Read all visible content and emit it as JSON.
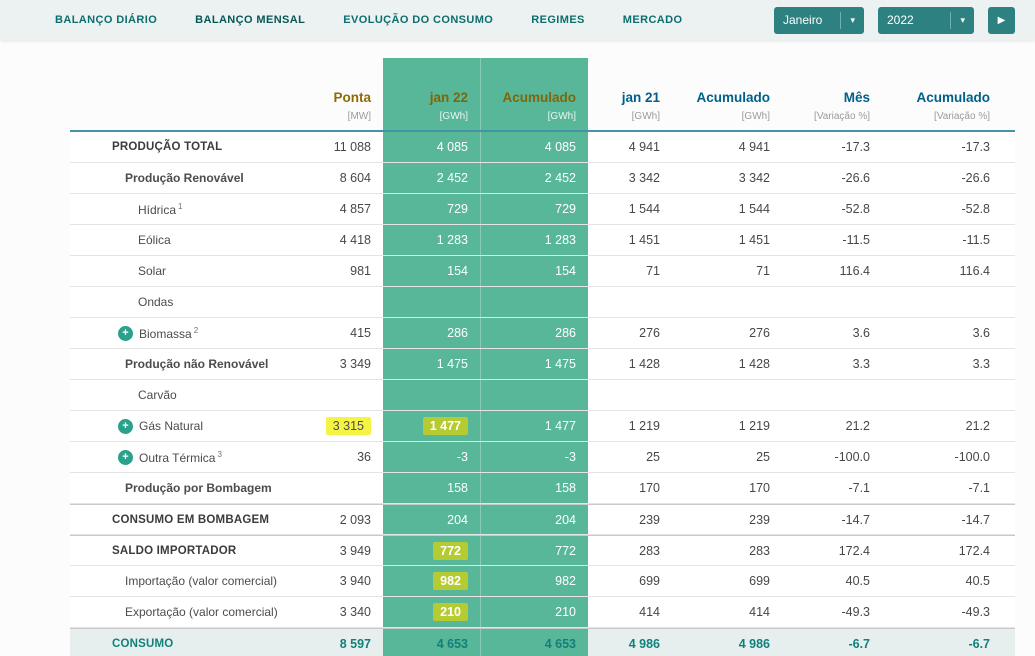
{
  "nav": {
    "items": [
      {
        "label": "BALANÇO DIÁRIO",
        "active": false
      },
      {
        "label": "BALANÇO MENSAL",
        "active": true
      },
      {
        "label": "EVOLUÇÃO DO CONSUMO",
        "active": false
      },
      {
        "label": "REGIMES",
        "active": false
      },
      {
        "label": "MERCADO",
        "active": false
      }
    ],
    "month_dropdown": {
      "value": "Janeiro",
      "caret": "▾"
    },
    "year_dropdown": {
      "value": "2022",
      "caret": "▾"
    },
    "next_button": "▶"
  },
  "colors": {
    "green_column": "#58b798",
    "highlight_yellow": "#f6f442",
    "highlight_lime": "#b6cb31",
    "header_gold": "#8f6b00",
    "header_blue": "#00608a",
    "teal_nav": "#0d6e6e",
    "consumo_row_bg": "#e7efee"
  },
  "table": {
    "columns": [
      {
        "key": "ponta",
        "label": "Ponta",
        "unit": "[MW]",
        "style": "gold"
      },
      {
        "key": "jan22",
        "label": "jan 22",
        "unit": "[GWh]",
        "style": "gold-on-green"
      },
      {
        "key": "acum22",
        "label": "Acumulado",
        "unit": "[GWh]",
        "style": "gold-on-green"
      },
      {
        "key": "jan21",
        "label": "jan 21",
        "unit": "[GWh]",
        "style": "blue"
      },
      {
        "key": "acum21",
        "label": "Acumulado",
        "unit": "[GWh]",
        "style": "blue"
      },
      {
        "key": "mes",
        "label": "Mês",
        "unit": "[Variação %]",
        "style": "blue"
      },
      {
        "key": "acum_var",
        "label": "Acumulado",
        "unit": "[Variação %]",
        "style": "blue"
      }
    ],
    "rows": [
      {
        "label": "PRODUÇÃO TOTAL",
        "style": "caps",
        "indent": 1,
        "cells": {
          "ponta": "11 088",
          "jan22": "4 085",
          "acum22": "4 085",
          "jan21": "4 941",
          "acum21": "4 941",
          "mes": "-17.3",
          "acum_var": "-17.3"
        }
      },
      {
        "label": "Produção Renovável",
        "style": "bold",
        "indent": 2,
        "cells": {
          "ponta": "8 604",
          "jan22": "2 452",
          "acum22": "2 452",
          "jan21": "3 342",
          "acum21": "3 342",
          "mes": "-26.6",
          "acum_var": "-26.6"
        }
      },
      {
        "label": "Hídrica",
        "sup": "1",
        "style": "normal",
        "indent": 3,
        "cells": {
          "ponta": "4 857",
          "jan22": "729",
          "acum22": "729",
          "jan21": "1 544",
          "acum21": "1 544",
          "mes": "-52.8",
          "acum_var": "-52.8"
        }
      },
      {
        "label": "Eólica",
        "style": "normal",
        "indent": 3,
        "cells": {
          "ponta": "4 418",
          "jan22": "1 283",
          "acum22": "1 283",
          "jan21": "1 451",
          "acum21": "1 451",
          "mes": "-11.5",
          "acum_var": "-11.5"
        }
      },
      {
        "label": "Solar",
        "style": "normal",
        "indent": 3,
        "cells": {
          "ponta": "981",
          "jan22": "154",
          "acum22": "154",
          "jan21": "71",
          "acum21": "71",
          "mes": "116.4",
          "acum_var": "116.4"
        }
      },
      {
        "label": "Ondas",
        "style": "normal",
        "indent": 3,
        "cells": {}
      },
      {
        "label": "Biomassa",
        "sup": "2",
        "style": "normal",
        "indent": 3,
        "plus": true,
        "cells": {
          "ponta": "415",
          "jan22": "286",
          "acum22": "286",
          "jan21": "276",
          "acum21": "276",
          "mes": "3.6",
          "acum_var": "3.6"
        }
      },
      {
        "label": "Produção não Renovável",
        "style": "bold",
        "indent": 2,
        "cells": {
          "ponta": "3 349",
          "jan22": "1 475",
          "acum22": "1 475",
          "jan21": "1 428",
          "acum21": "1 428",
          "mes": "3.3",
          "acum_var": "3.3"
        }
      },
      {
        "label": "Carvão",
        "style": "normal",
        "indent": 3,
        "cells": {}
      },
      {
        "label": "Gás Natural",
        "style": "normal",
        "indent": 3,
        "plus": true,
        "cells": {
          "ponta": "3 315",
          "jan22": "1 477",
          "acum22": "1 477",
          "jan21": "1 219",
          "acum21": "1 219",
          "mes": "21.2",
          "acum_var": "21.2"
        },
        "highlights": {
          "ponta": "yellow",
          "jan22": "lime"
        }
      },
      {
        "label": "Outra Térmica",
        "sup": "3",
        "style": "normal",
        "indent": 3,
        "plus": true,
        "cells": {
          "ponta": "36",
          "jan22": "-3",
          "acum22": "-3",
          "jan21": "25",
          "acum21": "25",
          "mes": "-100.0",
          "acum_var": "-100.0"
        }
      },
      {
        "label": "Produção por Bombagem",
        "style": "bold",
        "indent": 2,
        "cells": {
          "jan22": "158",
          "acum22": "158",
          "jan21": "170",
          "acum21": "170",
          "mes": "-7.1",
          "acum_var": "-7.1"
        }
      },
      {
        "label": "CONSUMO EM BOMBAGEM",
        "style": "caps",
        "indent": 1,
        "section": true,
        "cells": {
          "ponta": "2 093",
          "jan22": "204",
          "acum22": "204",
          "jan21": "239",
          "acum21": "239",
          "mes": "-14.7",
          "acum_var": "-14.7"
        }
      },
      {
        "label": "SALDO IMPORTADOR",
        "style": "caps",
        "indent": 1,
        "section": true,
        "cells": {
          "ponta": "3 949",
          "jan22": "772",
          "acum22": "772",
          "jan21": "283",
          "acum21": "283",
          "mes": "172.4",
          "acum_var": "172.4"
        },
        "highlights": {
          "jan22": "lime"
        }
      },
      {
        "label": "Importação (valor comercial)",
        "style": "normal",
        "indent": 2,
        "cells": {
          "ponta": "3 940",
          "jan22": "982",
          "acum22": "982",
          "jan21": "699",
          "acum21": "699",
          "mes": "40.5",
          "acum_var": "40.5"
        },
        "highlights": {
          "jan22": "lime"
        }
      },
      {
        "label": "Exportação (valor comercial)",
        "style": "normal",
        "indent": 2,
        "cells": {
          "ponta": "3 340",
          "jan22": "210",
          "acum22": "210",
          "jan21": "414",
          "acum21": "414",
          "mes": "-49.3",
          "acum_var": "-49.3"
        },
        "highlights": {
          "jan22": "lime"
        }
      },
      {
        "label": "CONSUMO",
        "style": "consumo",
        "indent": 1,
        "section": true,
        "cells": {
          "ponta": "8 597",
          "jan22": "4 653",
          "acum22": "4 653",
          "jan21": "4 986",
          "acum21": "4 986",
          "mes": "-6.7",
          "acum_var": "-6.7"
        }
      }
    ]
  }
}
